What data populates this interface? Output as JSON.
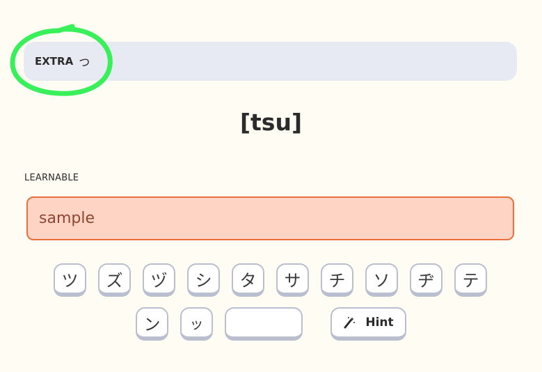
{
  "prompt": {
    "tag": "EXTRA",
    "kana": "つ"
  },
  "romaji": "[tsu]",
  "section_label": "LEARNABLE",
  "answer_input": {
    "value": "sample"
  },
  "keyboard": {
    "row1": [
      "ツ",
      "ズ",
      "ヅ",
      "シ",
      "タ",
      "サ",
      "チ",
      "ソ",
      "ヂ",
      "テ"
    ],
    "row2": [
      "ン",
      "ッ"
    ],
    "space_label": "",
    "hint_label": "Hint"
  },
  "colors": {
    "background": "#fefcf3",
    "prompt_bar": "#e7eaf2",
    "input_fill": "#fed5c4",
    "input_border": "#e9703d",
    "highlight": "#39f05a"
  }
}
